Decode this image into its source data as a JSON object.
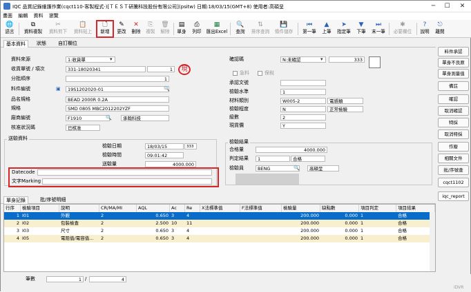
{
  "window": {
    "title": "IQC 品質記錄維護作業(cqct110-客製程式-)[ＴＥＳＴ研騰科技股份有限公司](psitw)  日期:18/03/15(GMT+8)  使用者:高碩呈"
  },
  "menu": [
    "畫面",
    "編輯",
    "資料",
    "瀏覽"
  ],
  "toolbar": [
    {
      "label": "語言",
      "icon": "globe-icon",
      "enabled": true
    },
    {
      "label": "資料複製",
      "icon": "copy-data-icon",
      "enabled": true
    },
    {
      "label": "資料剪下",
      "icon": "cut-data-icon",
      "enabled": false
    },
    {
      "label": "資料貼上",
      "icon": "paste-data-icon",
      "enabled": false
    },
    {
      "label": "新增",
      "icon": "new-doc-icon",
      "enabled": true
    },
    {
      "label": "更改",
      "icon": "edit-icon",
      "enabled": true
    },
    {
      "label": "刪除",
      "icon": "delete-icon",
      "enabled": true
    },
    {
      "label": "複製",
      "icon": "duplicate-icon",
      "enabled": false
    },
    {
      "label": "解除",
      "icon": "release-icon",
      "enabled": false
    },
    {
      "label": "單身",
      "icon": "detail-icon",
      "enabled": true
    },
    {
      "label": "列印",
      "icon": "print-icon",
      "enabled": true
    },
    {
      "label": "匯出Excel",
      "icon": "excel-icon",
      "enabled": true
    },
    {
      "label": "查詢",
      "icon": "query-icon",
      "enabled": true
    },
    {
      "label": "排序查詢",
      "icon": "sort-query-icon",
      "enabled": false
    },
    {
      "label": "條件儲存",
      "icon": "save-condition-icon",
      "enabled": false
    },
    {
      "label": "第一筆",
      "icon": "first-record-icon",
      "enabled": true
    },
    {
      "label": "上筆",
      "icon": "prev-record-icon",
      "enabled": true
    },
    {
      "label": "指定筆",
      "icon": "goto-record-icon",
      "enabled": true
    },
    {
      "label": "下筆",
      "icon": "next-record-icon",
      "enabled": true
    },
    {
      "label": "末一筆",
      "icon": "last-record-icon",
      "enabled": true
    },
    {
      "label": "必要欄位",
      "icon": "required-fields-icon",
      "enabled": false
    },
    {
      "label": "說明",
      "icon": "help-icon",
      "enabled": true
    },
    {
      "label": "離開",
      "icon": "exit-icon",
      "enabled": true
    }
  ],
  "tabs": [
    "基本資料",
    "狀態",
    "自訂欄位"
  ],
  "form": {
    "source_label": "資料來源",
    "source_value": "1:收貨單",
    "receipt_label": "收貨單號 / 項次",
    "receipt_no": "331-18020341",
    "receipt_item": "1",
    "batch_label": "分批順序",
    "batch_value": "1",
    "part_label": "料件編號",
    "part_value": "19S1202020-01",
    "name_label": "品名規格",
    "name_value": "BEAD 2000R 0.2A",
    "spec_label": "規格",
    "spec_value": "SMD 0805 MBC2012202YZF",
    "vendor_label": "廠商編號",
    "vendor_code": "F1910",
    "vendor_name": "承翰科技",
    "approval_label": "核准狀況碼",
    "approval_value": "已核准",
    "confirm_label": "確認碼",
    "confirm_value": "N:未確認",
    "confirm_extra": "333",
    "urgent_label": "急料",
    "bonded_label": "保稅",
    "doc_label": "承認文號",
    "level_label": "檢驗水準",
    "level_value": "1",
    "material_label": "材料類別",
    "material_code": "W005-2",
    "material_name": "電感類",
    "degree_label": "檢驗程度",
    "degree_code": "N",
    "degree_name": "正常檢驗",
    "class_label": "級數",
    "class_value": "2",
    "receipt_check_label": "現貨價",
    "receipt_check_value": "Y",
    "check_label": "送驗資料",
    "date_label": "檢驗日期",
    "date_value": "18/03/15",
    "date_extra": "333",
    "time_label": "檢驗時間",
    "time_value": "09:01:42",
    "qty_label": "送驗量",
    "qty_value": "4000.000",
    "datecode_label": "Datecode",
    "marking_label": "文字Marking",
    "result_group": "檢驗結果",
    "pass_label": "合格量",
    "pass_value": "4000.000",
    "judge_label": "判定結果",
    "judge_code": "1",
    "judge_name": "合格",
    "inspector_label": "檢驗員",
    "inspector_code": "BENG",
    "inspector_name": "高碩呈"
  },
  "seal_text": "現",
  "side_buttons": [
    "料件承認",
    "單身不良原",
    "單身測量值",
    "備註",
    "確認",
    "取消確認",
    "特採",
    "取消特採",
    "作廢",
    "相關文件",
    "批/序號查",
    "cqct1102",
    "iqc_report"
  ],
  "detail_tabs": [
    "單身記錄",
    "批/序號明細"
  ],
  "grid": {
    "columns": [
      "行序",
      "檢驗項目",
      "說明",
      "CR/MA/MI",
      "AQL",
      "Ac",
      "Re",
      "X法標準值",
      "F法標準值",
      "檢驗量",
      "缺點數",
      "項目判定",
      "項目結果"
    ],
    "rows": [
      [
        "1",
        "I01",
        "外觀",
        "2",
        "0.650",
        "3",
        "4",
        "",
        "",
        "200.000",
        "0.000",
        "1",
        "合格"
      ],
      [
        "2",
        "I02",
        "包裝檢查",
        "2",
        "2.500",
        "10",
        "11",
        "",
        "",
        "200.000",
        "0.000",
        "1",
        "合格"
      ],
      [
        "3",
        "I03",
        "尺寸",
        "2",
        "0.650",
        "3",
        "4",
        "",
        "",
        "200.000",
        "0.000",
        "1",
        "合格"
      ],
      [
        "4",
        "I05",
        "電阻值/電容值...",
        "2",
        "0.650",
        "3",
        "4",
        "",
        "",
        "200.000",
        "0.000",
        "1",
        "合格"
      ]
    ],
    "selected_row": 0
  },
  "status": {
    "count_label": "筆數",
    "current": "1",
    "total": "4",
    "brand": "iDVR"
  },
  "colors": {
    "selected": "#0a6cc9",
    "odd_row": "#f8efcf",
    "highlight": "#d7262a",
    "disabled_fill": "#cfcfcf"
  }
}
